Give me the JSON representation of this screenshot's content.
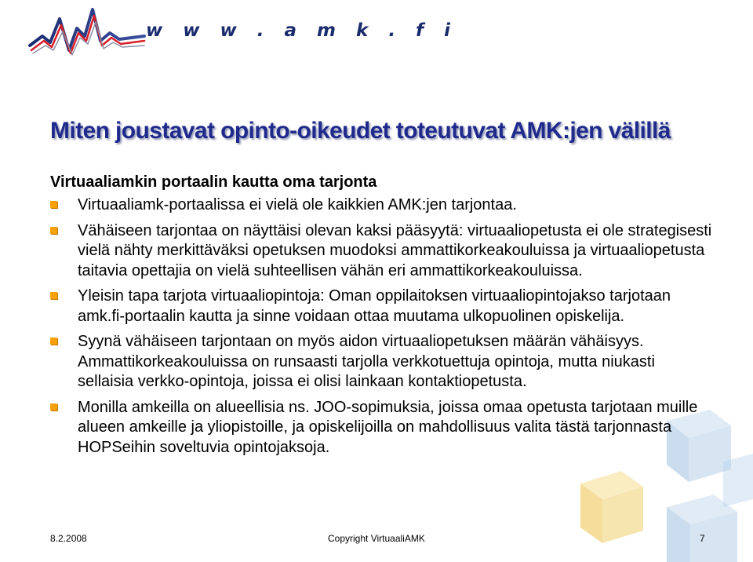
{
  "header": {
    "logo_url_text": "w w w . a m k . f i"
  },
  "title": "Miten joustavat opinto-oikeudet toteutuvat AMK:jen välillä",
  "subheading": "Virtuaaliamkin portaalin kautta oma tarjonta",
  "bullets": [
    "Virtuaaliamk-portaalissa ei vielä ole kaikkien AMK:jen tarjontaa.",
    "Vähäiseen tarjontaa on näyttäisi olevan kaksi pääsyytä: virtuaaliopetusta ei ole strategisesti vielä nähty merkittäväksi opetuksen muodoksi ammattikorkeakouluissa ja virtuaaliopetusta taitavia opettajia on vielä suhteellisen vähän eri ammattikorkeakouluissa.",
    "Yleisin tapa tarjota virtuaaliopintoja: Oman oppilaitoksen virtuaaliopintojakso tarjotaan amk.fi-portaalin kautta ja sinne voidaan ottaa muutama ulkopuolinen opiskelija.",
    "Syynä vähäiseen tarjontaan on myös aidon virtuaaliopetuksen määrän vähäisyys. Ammattikorkeakouluissa on  runsaasti tarjolla verkkotuettuja opintoja, mutta niukasti sellaisia verkko-opintoja, joissa ei olisi lainkaan kontaktiopetusta.",
    "Monilla amkeilla on alueellisia ns. JOO-sopimuksia, joissa omaa opetusta tarjotaan muille alueen amkeille ja yliopistoille, ja opiskelijoilla on mahdollisuus valita tästä tarjonnasta HOPSeihin soveltuvia opintojaksoja."
  ],
  "footer": {
    "date": "8.2.2008",
    "copyright": "Copyright VirtuaaliAMK",
    "page": "7"
  },
  "colors": {
    "title": "#1f2a8c",
    "bullet_marker": "#f7a10a",
    "logo_text": "#1b2c6e",
    "logo_red": "#d81e28",
    "cube_blue": "#8fb4d8",
    "cube_yellow": "#f3cf5a"
  },
  "icons": {
    "bullet": "orange-square-icon",
    "logo": "amk-wave-logo"
  }
}
